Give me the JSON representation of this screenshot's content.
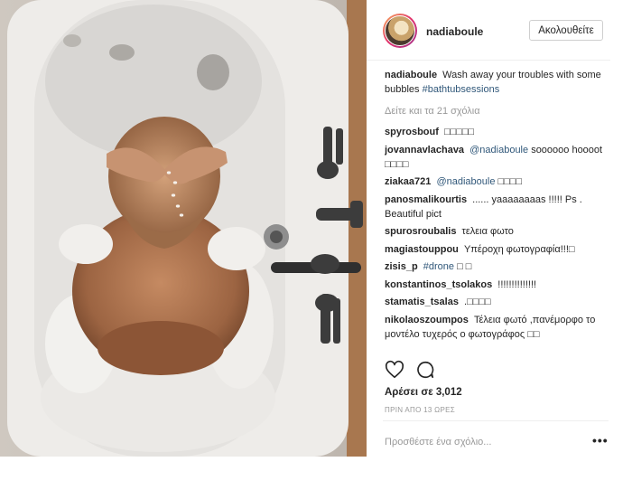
{
  "post": {
    "username": "nadiaboule",
    "follow_label": "Ακολουθείτε",
    "caption": {
      "username": "nadiaboule",
      "text": "Wash away your troubles with some bubbles",
      "hashtag": "#bathtubsessions"
    },
    "view_more": "Δείτε και τα 21 σχόλια",
    "comments": [
      {
        "user": "spyrosbouf",
        "text": "□□□□□"
      },
      {
        "user": "jovannavlachava",
        "mention": "@nadiaboule",
        "text": "soooooo hoooot □□□□"
      },
      {
        "user": "ziakaa721",
        "mention": "@nadiaboule",
        "text": "□□□□"
      },
      {
        "user": "panosmalikourtis",
        "text": "...... yaaaaaaaas !!!!! Ps . Beautiful pict"
      },
      {
        "user": "spurosroubalis",
        "text": "τελεια φωτο"
      },
      {
        "user": "magiastouppou",
        "text": "Υπέροχη φωτογραφία!!!□"
      },
      {
        "user": "zisis_p",
        "mention": "#drone",
        "text": "□ □"
      },
      {
        "user": "konstantinos_tsolakos",
        "text": "!!!!!!!!!!!!!!"
      },
      {
        "user": "stamatis_tsalas",
        "text": ".□□□□"
      },
      {
        "user": "nikolaoszoumpos",
        "text": "Τέλεια φωτό ,πανέμορφο το μοντέλο τυχερός ο φωτογράφος □□"
      }
    ],
    "likes": "Αρέσει σε 3,012",
    "timestamp": "ΠΡΙΝ ΑΠΟ 13 ΩΡΕΣ",
    "add_comment_placeholder": "Προσθέστε ένα σχόλιο...",
    "more_options": "•••",
    "icons": [
      "heart-icon",
      "comment-icon",
      "more-options-icon"
    ]
  }
}
